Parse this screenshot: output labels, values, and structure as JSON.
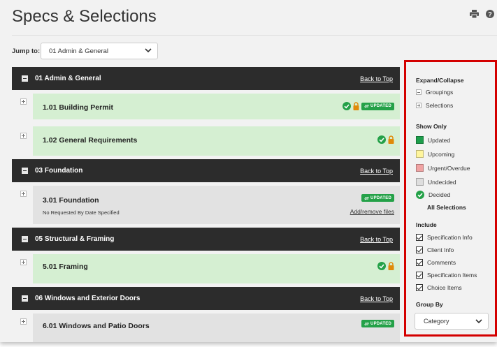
{
  "page": {
    "title": "Specs & Selections",
    "header_icons": [
      "printer-icon",
      "help-icon"
    ]
  },
  "jump": {
    "label": "Jump to:",
    "selected": "01 Admin & General"
  },
  "groups": [
    {
      "name": "01 Admin & General",
      "back_to_top": "Back to Top",
      "items": [
        {
          "name": "1.01 Building Permit",
          "status": "decided",
          "locked": true,
          "updated_label": "UPDATED"
        },
        {
          "name": "1.02 General Requirements",
          "status": "decided",
          "locked": true
        }
      ]
    },
    {
      "name": "03 Foundation",
      "back_to_top": "Back to Top",
      "items": [
        {
          "name": "3.01 Foundation",
          "status": "undecided",
          "updated_label": "UPDATED",
          "note": "No Requested By Date Specified",
          "files_link": "Add/remove files"
        }
      ]
    },
    {
      "name": "05 Structural & Framing",
      "back_to_top": "Back to Top",
      "items": [
        {
          "name": "5.01 Framing",
          "status": "decided",
          "locked": true
        }
      ]
    },
    {
      "name": "06 Windows and Exterior Doors",
      "back_to_top": "Back to Top",
      "items": [
        {
          "name": "6.01 Windows and Patio Doors",
          "status": "undecided",
          "updated_label": "UPDATED"
        }
      ]
    }
  ],
  "panel": {
    "expand_collapse": {
      "title": "Expand/Collapse",
      "groupings": "Groupings",
      "selections": "Selections"
    },
    "show_only": {
      "title": "Show Only",
      "updated": "Updated",
      "upcoming": "Upcoming",
      "urgent": "Urgent/Overdue",
      "undecided": "Undecided",
      "decided": "Decided",
      "all": "All Selections"
    },
    "include": {
      "title": "Include",
      "spec_info": "Specification Info",
      "client_info": "Client Info",
      "comments": "Comments",
      "spec_items": "Specification Items",
      "choice_items": "Choice Items"
    },
    "group_by": {
      "title": "Group By",
      "selected": "Category"
    }
  },
  "colors": {
    "decided_green": "#24a148",
    "lock_orange": "#e08a0a",
    "updated_swatch": "#1e9e4c",
    "upcoming_swatch": "#fff59d",
    "urgent_swatch": "#f0a3a3",
    "undecided_swatch": "#dedede",
    "group_header": "#2c2c2c",
    "decided_row": "#d5efd2",
    "panel_border": "#d40000"
  }
}
